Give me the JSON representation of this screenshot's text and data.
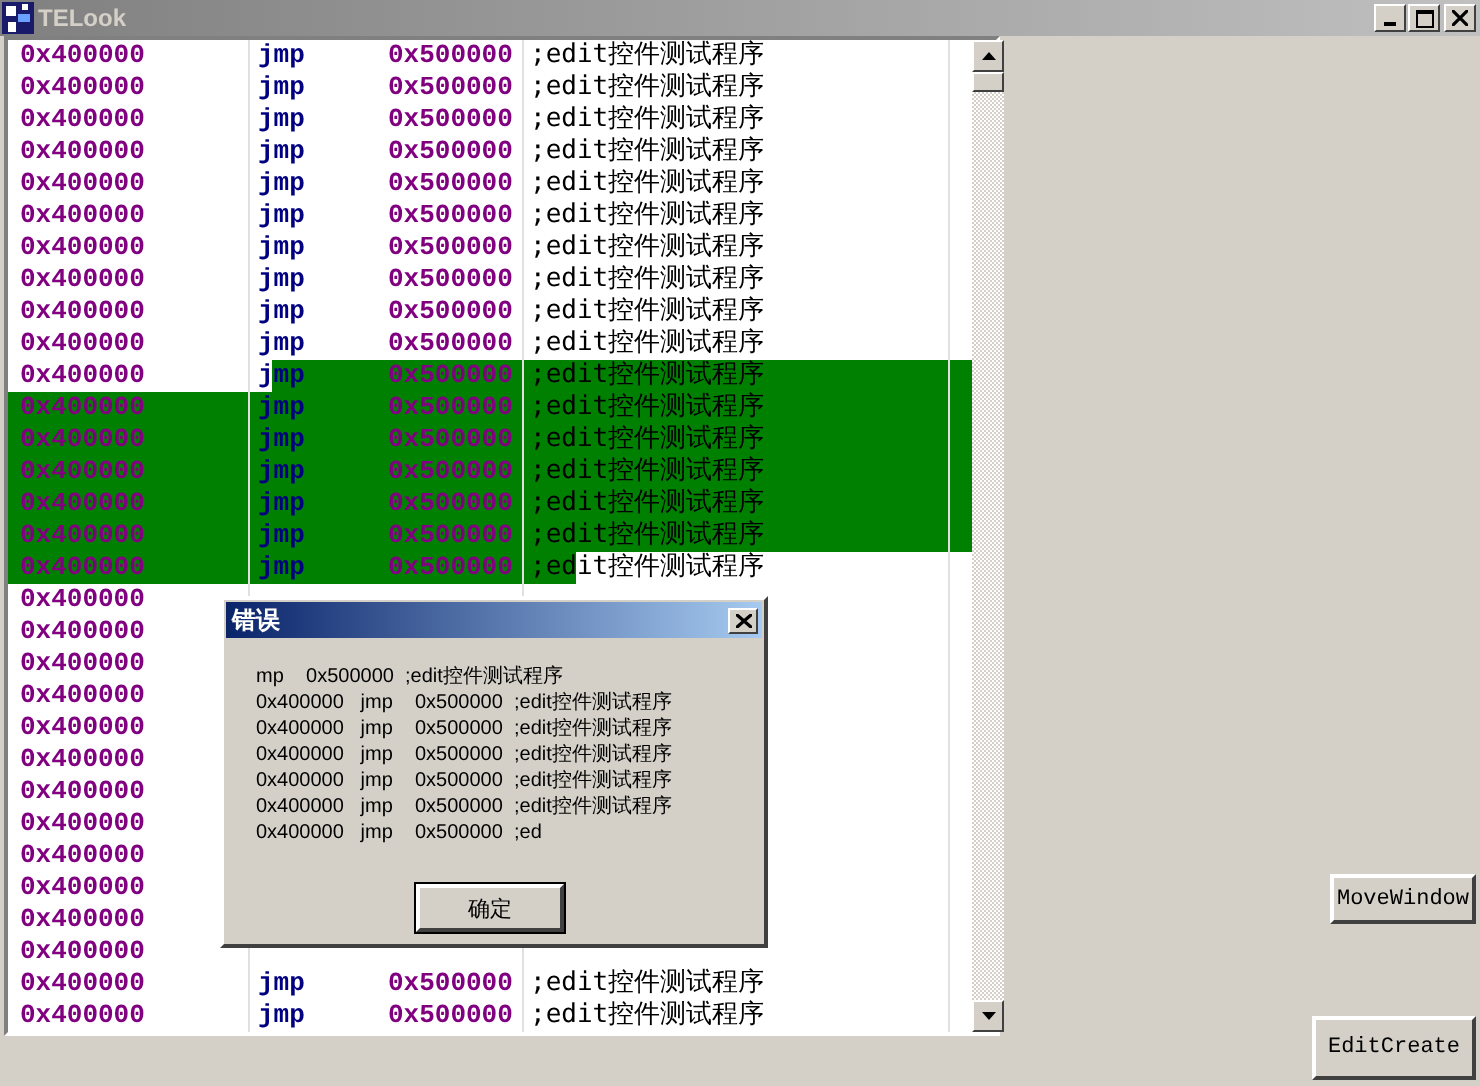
{
  "window": {
    "title": "TELook"
  },
  "listing": {
    "rows": [
      {
        "address": "0x400000",
        "opcode": "jmp",
        "operand": "0x500000",
        "comment": ";edit控件测试程序",
        "selected": false
      },
      {
        "address": "0x400000",
        "opcode": "jmp",
        "operand": "0x500000",
        "comment": ";edit控件测试程序",
        "selected": false
      },
      {
        "address": "0x400000",
        "opcode": "jmp",
        "operand": "0x500000",
        "comment": ";edit控件测试程序",
        "selected": false
      },
      {
        "address": "0x400000",
        "opcode": "jmp",
        "operand": "0x500000",
        "comment": ";edit控件测试程序",
        "selected": false
      },
      {
        "address": "0x400000",
        "opcode": "jmp",
        "operand": "0x500000",
        "comment": ";edit控件测试程序",
        "selected": false
      },
      {
        "address": "0x400000",
        "opcode": "jmp",
        "operand": "0x500000",
        "comment": ";edit控件测试程序",
        "selected": false
      },
      {
        "address": "0x400000",
        "opcode": "jmp",
        "operand": "0x500000",
        "comment": ";edit控件测试程序",
        "selected": false
      },
      {
        "address": "0x400000",
        "opcode": "jmp",
        "operand": "0x500000",
        "comment": ";edit控件测试程序",
        "selected": false
      },
      {
        "address": "0x400000",
        "opcode": "jmp",
        "operand": "0x500000",
        "comment": ";edit控件测试程序",
        "selected": false
      },
      {
        "address": "0x400000",
        "opcode": "jmp",
        "operand": "0x500000",
        "comment": ";edit控件测试程序",
        "selected": false
      },
      {
        "address": "0x400000",
        "opcode": "jmp",
        "operand": "0x500000",
        "comment": ";edit控件测试程序",
        "selected": true,
        "kind": "start"
      },
      {
        "address": "0x400000",
        "opcode": "jmp",
        "operand": "0x500000",
        "comment": ";edit控件测试程序",
        "selected": true,
        "kind": "line"
      },
      {
        "address": "0x400000",
        "opcode": "jmp",
        "operand": "0x500000",
        "comment": ";edit控件测试程序",
        "selected": true,
        "kind": "line"
      },
      {
        "address": "0x400000",
        "opcode": "jmp",
        "operand": "0x500000",
        "comment": ";edit控件测试程序",
        "selected": true,
        "kind": "line"
      },
      {
        "address": "0x400000",
        "opcode": "jmp",
        "operand": "0x500000",
        "comment": ";edit控件测试程序",
        "selected": true,
        "kind": "line"
      },
      {
        "address": "0x400000",
        "opcode": "jmp",
        "operand": "0x500000",
        "comment": ";edit控件测试程序",
        "selected": true,
        "kind": "line"
      },
      {
        "address": "0x400000",
        "opcode": "jmp",
        "operand": "0x500000",
        "comment": ";edit控件测试程序",
        "selected": true,
        "kind": "end"
      },
      {
        "address": "0x400000",
        "selected": false
      },
      {
        "address": "0x400000",
        "selected": false
      },
      {
        "address": "0x400000",
        "selected": false
      },
      {
        "address": "0x400000",
        "selected": false
      },
      {
        "address": "0x400000",
        "selected": false
      },
      {
        "address": "0x400000",
        "selected": false
      },
      {
        "address": "0x400000",
        "selected": false
      },
      {
        "address": "0x400000",
        "selected": false
      },
      {
        "address": "0x400000",
        "selected": false
      },
      {
        "address": "0x400000",
        "selected": false
      },
      {
        "address": "0x400000",
        "selected": false
      },
      {
        "address": "0x400000",
        "selected": false
      },
      {
        "address": "0x400000",
        "opcode": "jmp",
        "operand": "0x500000",
        "comment": ";edit控件测试程序",
        "selected": false
      },
      {
        "address": "0x400000",
        "opcode": "jmp",
        "operand": "0x500000",
        "comment": ";edit控件测试程序",
        "selected": false
      }
    ]
  },
  "dialog": {
    "title": "错误",
    "lines": [
      "mp    0x500000  ;edit控件测试程序",
      "0x400000   jmp    0x500000  ;edit控件测试程序",
      "0x400000   jmp    0x500000  ;edit控件测试程序",
      "0x400000   jmp    0x500000  ;edit控件测试程序",
      "0x400000   jmp    0x500000  ;edit控件测试程序",
      "0x400000   jmp    0x500000  ;edit控件测试程序",
      "0x400000   jmp    0x500000  ;ed"
    ],
    "button": "确定"
  },
  "buttons": [
    {
      "label": "MoveWindow"
    },
    {
      "label": "EditCreate"
    }
  ]
}
